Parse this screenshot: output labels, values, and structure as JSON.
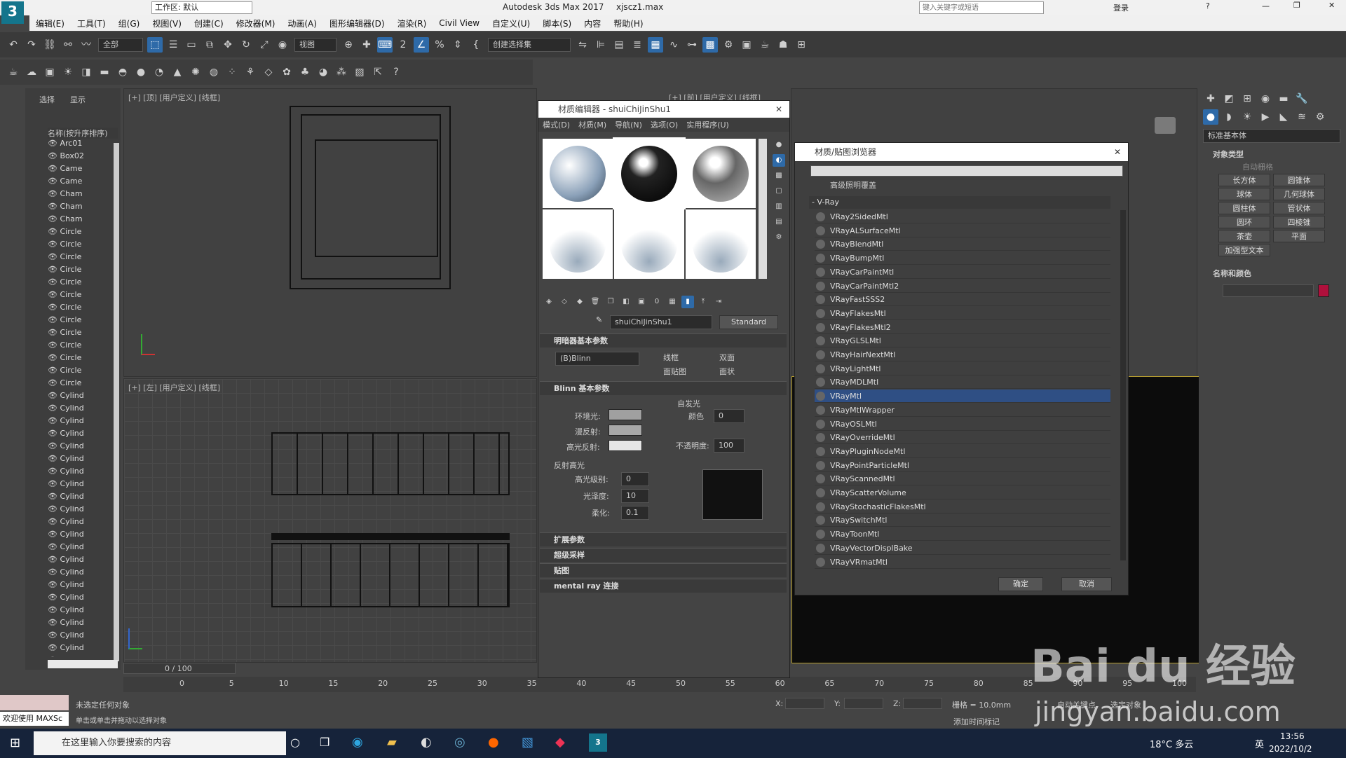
{
  "titlebar": {
    "app_title": "Autodesk 3ds Max 2017",
    "file_name": "xjscz1.max",
    "workspace": "工作区: 默认",
    "search_placeholder": "键入关键字或短语",
    "login": "登录"
  },
  "menu": [
    "编辑(E)",
    "工具(T)",
    "组(G)",
    "视图(V)",
    "创建(C)",
    "修改器(M)",
    "动画(A)",
    "图形编辑器(D)",
    "渲染(R)",
    "Civil View",
    "自定义(U)",
    "脚本(S)",
    "内容",
    "帮助(H)"
  ],
  "toolbar": {
    "filter": "全部",
    "view_dd": "视图",
    "selection_set": "创建选择集"
  },
  "explorer": {
    "tab_select": "选择",
    "tab_display": "显示",
    "column": "名称(按升序排序)",
    "items": [
      "Arc01",
      "Box02",
      "Came",
      "Came",
      "Cham",
      "Cham",
      "Cham",
      "Circle",
      "Circle",
      "Circle",
      "Circle",
      "Circle",
      "Circle",
      "Circle",
      "Circle",
      "Circle",
      "Circle",
      "Circle",
      "Circle",
      "Circle",
      "Cylind",
      "Cylind",
      "Cylind",
      "Cylind",
      "Cylind",
      "Cylind",
      "Cylind",
      "Cylind",
      "Cylind",
      "Cylind",
      "Cylind",
      "Cylind",
      "Cylind",
      "Cylind",
      "Cylind",
      "Cylind",
      "Cylind",
      "Cylind",
      "Cylind",
      "Cylind",
      "Cylind",
      "Cylind"
    ]
  },
  "viewports": {
    "top_label": "[+] [顶] [用户定义] [线框]",
    "left_label": "[+] [左] [用户定义] [线框]",
    "right_label": "[+] [前] [用户定义] [线框]",
    "timeline_pos": "0 / 100"
  },
  "mat_editor": {
    "title": "材质编辑器 - shuiChiJinShu1",
    "menus": [
      "模式(D)",
      "材质(M)",
      "导航(N)",
      "选项(O)",
      "实用程序(U)"
    ],
    "mat_name": "shuiChiJinShu1",
    "mat_type": "Standard",
    "shader_rollout": "明暗器基本参数",
    "shader": "(B)Blinn",
    "chk": [
      "线框",
      "双面",
      "面贴图",
      "面状"
    ],
    "blinn_rollout": "Blinn 基本参数",
    "self_illum": "自发光",
    "color": "颜色",
    "color_val": "0",
    "ambient": "环境光:",
    "diffuse": "漫反射:",
    "specular": "高光反射:",
    "opacity": "不透明度:",
    "opacity_val": "100",
    "spec_group": "反射高光",
    "spec_level": "高光级别:",
    "spec_level_val": "0",
    "gloss": "光泽度:",
    "gloss_val": "10",
    "soften": "柔化:",
    "soften_val": "0.1",
    "rollouts": [
      "扩展参数",
      "超级采样",
      "贴图",
      "mental ray 连接"
    ]
  },
  "browser": {
    "title": "材质/贴图浏览器",
    "prev_item": "高级照明覆盖",
    "group": "- V-Ray",
    "items": [
      "VRay2SidedMtl",
      "VRayALSurfaceMtl",
      "VRayBlendMtl",
      "VRayBumpMtl",
      "VRayCarPaintMtl",
      "VRayCarPaintMtl2",
      "VRayFastSSS2",
      "VRayFlakesMtl",
      "VRayFlakesMtl2",
      "VRayGLSLMtl",
      "VRayHairNextMtl",
      "VRayLightMtl",
      "VRayMDLMtl",
      "VRayMtl",
      "VRayMtlWrapper",
      "VRayOSLMtl",
      "VRayOverrideMtl",
      "VRayPluginNodeMtl",
      "VRayPointParticleMtl",
      "VRayScannedMtl",
      "VRayScatterVolume",
      "VRayStochasticFlakesMtl",
      "VRaySwitchMtl",
      "VRayToonMtl",
      "VRayVectorDisplBake",
      "VRayVRmatMtl"
    ],
    "selected": "VRayMtl",
    "ok": "确定",
    "cancel": "取消"
  },
  "cmd": {
    "dropdown": "标准基本体",
    "obj_type": "对象类型",
    "autogrid": "自动栅格",
    "buttons": [
      "长方体",
      "圆锥体",
      "球体",
      "几何球体",
      "圆柱体",
      "管状体",
      "圆环",
      "四棱锥",
      "茶壶",
      "平面",
      "加强型文本"
    ],
    "name_color": "名称和颜色",
    "swatch_color": "#b0103c"
  },
  "status": {
    "maxscript": "欢迎使用 MAXSc",
    "msg1": "未选定任何对象",
    "msg2": "单击或单击并拖动以选择对象",
    "x": "X:",
    "y": "Y:",
    "z": "Z:",
    "grid": "栅格 = 10.0mm",
    "add_tag": "添加时间标记",
    "autokey": "自动关键点",
    "setkey": "选定对象"
  },
  "timeline_ticks": [
    "0",
    "5",
    "10",
    "15",
    "20",
    "25",
    "30",
    "35",
    "40",
    "45",
    "50",
    "55",
    "60",
    "65",
    "70",
    "75",
    "80",
    "85",
    "90",
    "95",
    "100"
  ],
  "taskbar": {
    "search": "在这里输入你要搜索的内容",
    "weather": "18°C 多云",
    "ime": "英",
    "time": "13:56",
    "date": "2022/10/2"
  },
  "watermark": {
    "brand": "Bai du 经验",
    "url": "jingyan.baidu.com"
  }
}
